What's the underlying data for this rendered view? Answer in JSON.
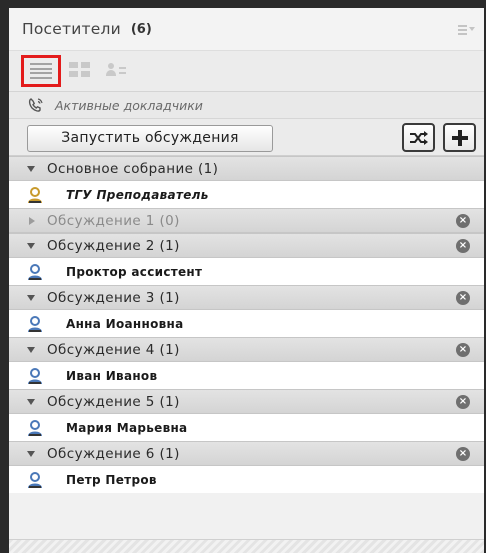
{
  "panel": {
    "title": "Посетители",
    "count": "(6)"
  },
  "speakers": {
    "label": "Активные докладчики"
  },
  "actions": {
    "start_label": "Запустить обсуждения"
  },
  "groups": [
    {
      "name": "Основное собрание (1)",
      "expanded": true,
      "closable": false,
      "members": [
        "ТГУ Преподаватель"
      ]
    },
    {
      "name": "Обсуждение 1 (0)",
      "expanded": false,
      "closable": true,
      "members": []
    },
    {
      "name": "Обсуждение 2 (1)",
      "expanded": true,
      "closable": true,
      "members": [
        "Проктор ассистент"
      ]
    },
    {
      "name": "Обсуждение 3 (1)",
      "expanded": true,
      "closable": true,
      "members": [
        "Анна Иоанновна"
      ]
    },
    {
      "name": "Обсуждение 4 (1)",
      "expanded": true,
      "closable": true,
      "members": [
        "Иван Иванов"
      ]
    },
    {
      "name": "Обсуждение 5 (1)",
      "expanded": true,
      "closable": true,
      "members": [
        "Мария Марьевна"
      ]
    },
    {
      "name": "Обсуждение 6 (1)",
      "expanded": true,
      "closable": true,
      "members": [
        "Петр Петров"
      ]
    }
  ],
  "colors": {
    "highlight": "#e31b1b",
    "user_icon": "#4a78b8",
    "host_icon": "#c89a2c"
  }
}
